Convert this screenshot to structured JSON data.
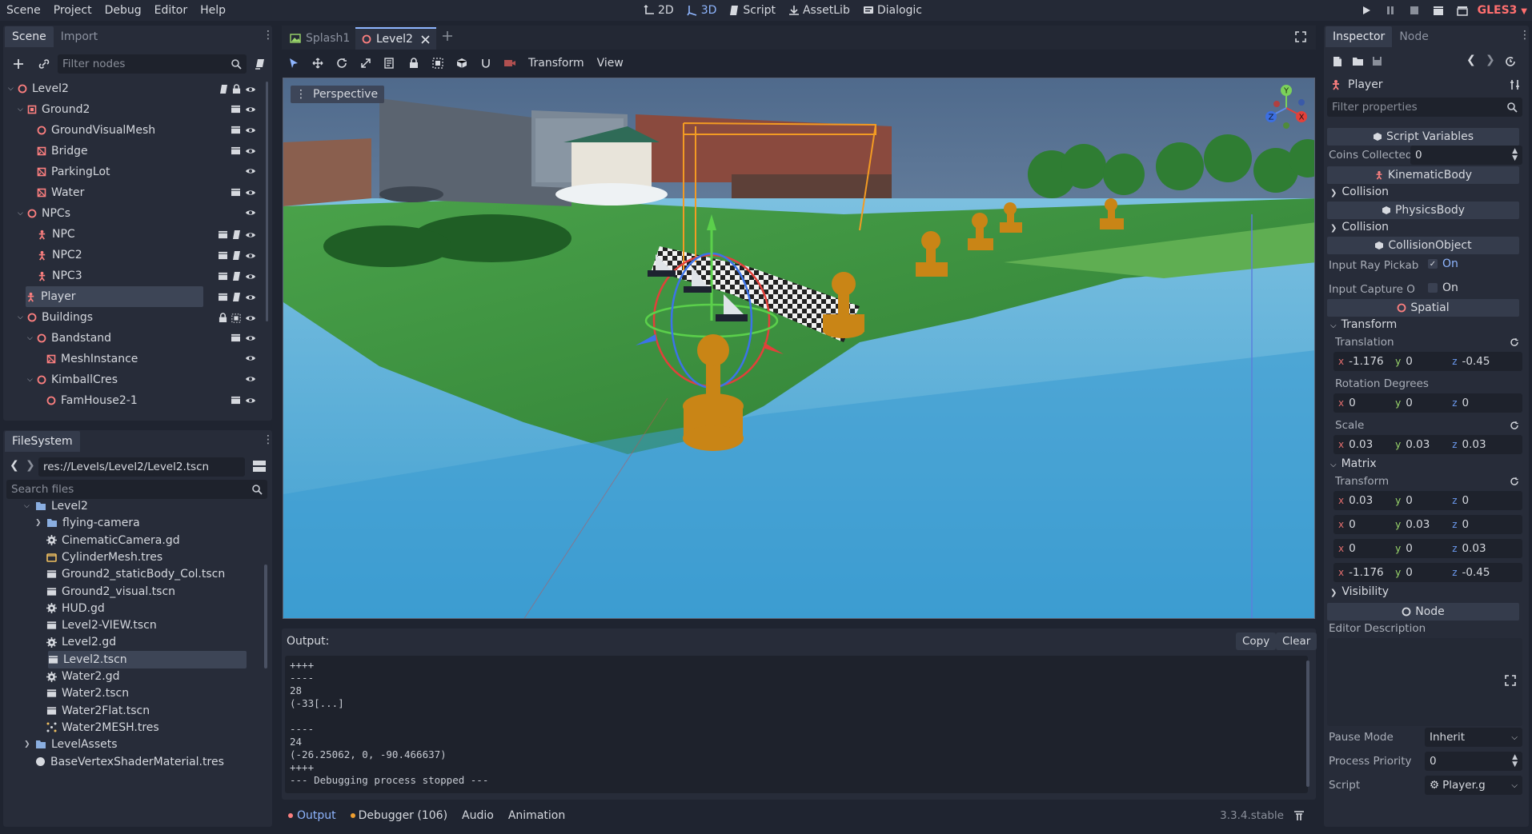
{
  "menubar": {
    "items": [
      "Scene",
      "Project",
      "Debug",
      "Editor",
      "Help"
    ],
    "workspaces": [
      "2D",
      "3D",
      "Script",
      "AssetLib",
      "Dialogic"
    ],
    "active_workspace": "3D",
    "renderer": "GLES3"
  },
  "scene_dock": {
    "tabs": [
      "Scene",
      "Import"
    ],
    "filter_placeholder": "Filter nodes",
    "tree": [
      {
        "label": "Level2",
        "icon": "spatial-icon",
        "depth": 0,
        "expanded": true
      },
      {
        "label": "Ground2",
        "icon": "node3d-box-icon",
        "depth": 1,
        "expanded": true
      },
      {
        "label": "GroundVisualMesh",
        "icon": "spatial-icon",
        "depth": 2
      },
      {
        "label": "Bridge",
        "icon": "mesh-icon",
        "depth": 2
      },
      {
        "label": "ParkingLot",
        "icon": "mesh-icon",
        "depth": 2
      },
      {
        "label": "Water",
        "icon": "mesh-icon",
        "depth": 2
      },
      {
        "label": "NPCs",
        "icon": "spatial-icon",
        "depth": 1,
        "expanded": true
      },
      {
        "label": "NPC",
        "icon": "kinematic-icon",
        "depth": 2
      },
      {
        "label": "NPC2",
        "icon": "kinematic-icon",
        "depth": 2
      },
      {
        "label": "NPC3",
        "icon": "kinematic-icon",
        "depth": 2
      },
      {
        "label": "Player",
        "icon": "kinematic-icon",
        "depth": 1,
        "selected": true
      },
      {
        "label": "Buildings",
        "icon": "spatial-icon",
        "depth": 1,
        "expanded": true
      },
      {
        "label": "Bandstand",
        "icon": "spatial-icon",
        "depth": 2,
        "expanded": true
      },
      {
        "label": "MeshInstance",
        "icon": "mesh-icon",
        "depth": 3
      },
      {
        "label": "KimballCres",
        "icon": "spatial-icon",
        "depth": 2,
        "expanded": true
      },
      {
        "label": "FamHouse2-1",
        "icon": "spatial-icon",
        "depth": 3
      }
    ]
  },
  "filesystem_dock": {
    "title": "FileSystem",
    "path": "res://Levels/Level2/Level2.tscn",
    "search_placeholder": "Search files",
    "items": [
      {
        "label": "Level2",
        "type": "folder",
        "depth": 0,
        "expanded": true
      },
      {
        "label": "flying-camera",
        "type": "folder",
        "depth": 1
      },
      {
        "label": "CinematicCamera.gd",
        "type": "script",
        "depth": 1
      },
      {
        "label": "CylinderMesh.tres",
        "type": "resource",
        "depth": 1
      },
      {
        "label": "Ground2_staticBody_Col.tscn",
        "type": "scene",
        "depth": 1
      },
      {
        "label": "Ground2_visual.tscn",
        "type": "scene",
        "depth": 1
      },
      {
        "label": "HUD.gd",
        "type": "script",
        "depth": 1
      },
      {
        "label": "Level2-VIEW.tscn",
        "type": "scene",
        "depth": 1
      },
      {
        "label": "Level2.gd",
        "type": "script",
        "depth": 1
      },
      {
        "label": "Level2.tscn",
        "type": "scene",
        "depth": 1,
        "selected": true
      },
      {
        "label": "Water2.gd",
        "type": "script",
        "depth": 1
      },
      {
        "label": "Water2.tscn",
        "type": "scene",
        "depth": 1
      },
      {
        "label": "Water2Flat.tscn",
        "type": "scene",
        "depth": 1
      },
      {
        "label": "Water2MESH.tres",
        "type": "mesh",
        "depth": 1
      },
      {
        "label": "LevelAssets",
        "type": "folder",
        "depth": 0
      },
      {
        "label": "BaseVertexShaderMaterial.tres",
        "type": "material",
        "depth": 0
      }
    ]
  },
  "editor_tabs": {
    "tabs": [
      "Splash1",
      "Level2"
    ],
    "active": "Level2"
  },
  "viewport": {
    "menus": [
      "Transform",
      "View"
    ],
    "perspective_label": "Perspective",
    "gizmo_axes": [
      "X",
      "Y",
      "Z"
    ]
  },
  "output": {
    "title": "Output:",
    "copy_label": "Copy",
    "clear_label": "Clear",
    "lines": [
      "++++",
      "----",
      "28",
      "(-33[...]",
      "",
      "----",
      "24",
      "(-26.25062, 0, -90.466637)",
      "++++",
      "--- Debugging process stopped ---"
    ]
  },
  "bottom_bar": {
    "tabs": [
      "Output",
      "Debugger (106)",
      "Audio",
      "Animation"
    ],
    "version": "3.3.4.stable"
  },
  "inspector": {
    "tabs": [
      "Inspector",
      "Node"
    ],
    "node_name": "Player",
    "filter_placeholder": "Filter properties",
    "sections": {
      "script_variables": "Script Variables",
      "kinematic_body": "KinematicBody",
      "physics_body": "PhysicsBody",
      "collision_object": "CollisionObject",
      "spatial": "Spatial",
      "node": "Node"
    },
    "coins_label": "Coins Collected",
    "coins_value": "0",
    "collision_label": "Collision",
    "collision2_label": "Collision",
    "input_ray_label": "Input Ray Pickab",
    "input_ray_value": "On",
    "input_capture_label": "Input Capture O",
    "input_capture_value": "On",
    "transform_label": "Transform",
    "translation_label": "Translation",
    "translation": {
      "x": "-1.176",
      "y": "0",
      "z": "-0.45"
    },
    "rotation_label": "Rotation Degrees",
    "rotation": {
      "x": "0",
      "y": "0",
      "z": "0"
    },
    "scale_label": "Scale",
    "scale": {
      "x": "0.03",
      "y": "0.03",
      "z": "0.03"
    },
    "matrix_label": "Matrix",
    "matrix_transform_label": "Transform",
    "matrix_rows": [
      {
        "x": "0.03",
        "y": "0",
        "z": "0"
      },
      {
        "x": "0",
        "y": "0.03",
        "z": "0"
      },
      {
        "x": "0",
        "y": "0",
        "z": "0.03"
      },
      {
        "x": "-1.176",
        "y": "0",
        "z": "-0.45"
      }
    ],
    "visibility_label": "Visibility",
    "editor_desc_label": "Editor Description",
    "pause_mode_label": "Pause Mode",
    "pause_mode_value": "Inherit",
    "process_priority_label": "Process Priority",
    "process_priority_value": "0",
    "script_label": "Script",
    "script_value": "Player.g"
  },
  "colors": {
    "accent": "#8fb6ff",
    "node3d_red": "#fc7f7f",
    "background": "#1f2430",
    "panel": "#272c39"
  }
}
